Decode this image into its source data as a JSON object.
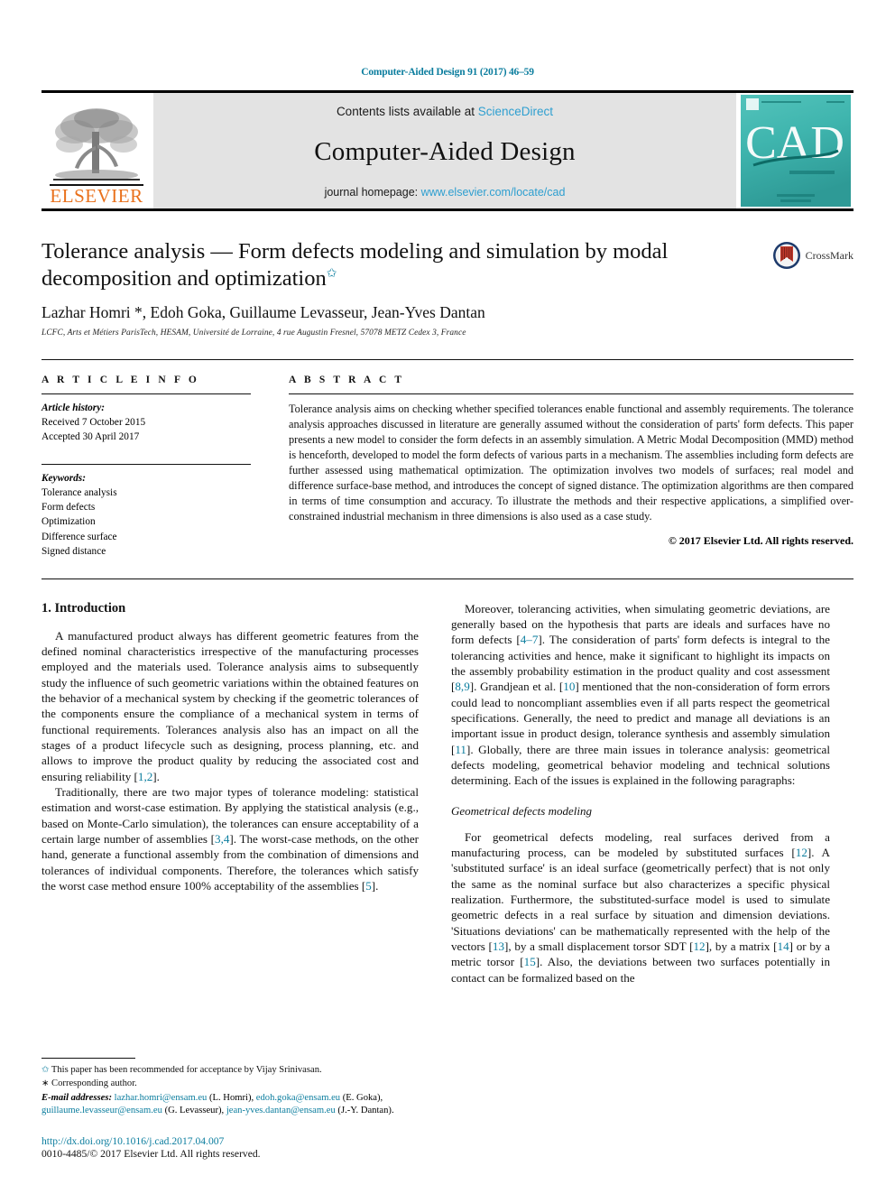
{
  "running_head": "Computer-Aided Design 91 (2017) 46–59",
  "masthead": {
    "publisher_name": "ELSEVIER",
    "contents_prefix": "Contents lists available at ",
    "sciencedirect": "ScienceDirect",
    "journal_name": "Computer-Aided Design",
    "homepage_prefix": "journal homepage: ",
    "homepage_url": "www.elsevier.com/locate/cad",
    "cover_title": "CAD",
    "cover_subtitle": "COMPUTER-AIDED DESIGN",
    "accent_color": "#2e9fd0",
    "link_color": "#0b7d9e",
    "cover_color": "#3fb5ae",
    "elsevier_orange": "#E9711C"
  },
  "article": {
    "title": "Tolerance analysis — Form defects modeling and simulation by modal decomposition and optimization",
    "title_footnote_mark": "✩",
    "authors": "Lazhar Homri *, Edoh Goka, Guillaume Levasseur, Jean-Yves Dantan",
    "affiliation": "LCFC, Arts et Métiers ParisTech, HESAM, Université de Lorraine, 4 rue Augustin Fresnel, 57078 METZ Cedex 3, France",
    "crossmark_label": "CrossMark"
  },
  "info": {
    "heading": "A R T I C L E   I N F O",
    "history_label": "Article history:",
    "history": [
      "Received 7 October 2015",
      "Accepted 30 April 2017"
    ],
    "keywords_label": "Keywords:",
    "keywords": [
      "Tolerance analysis",
      "Form defects",
      "Optimization",
      "Difference surface",
      "Signed distance"
    ]
  },
  "abstract": {
    "heading": "A B S T R A C T",
    "text": "Tolerance analysis aims on checking whether specified tolerances enable functional and assembly requirements. The tolerance analysis approaches discussed in literature are generally assumed without the consideration of parts' form defects. This paper presents a new model to consider the form defects in an assembly simulation. A Metric Modal Decomposition (MMD) method is henceforth, developed to model the form defects of various parts in a mechanism. The assemblies including form defects are further assessed using mathematical optimization. The optimization involves two models of surfaces; real model and difference surface-base method, and introduces the concept of signed distance. The optimization algorithms are then compared in terms of time consumption and accuracy. To illustrate the methods and their respective applications, a simplified over-constrained industrial mechanism in three dimensions is also used as a case study.",
    "copyright": "© 2017 Elsevier Ltd. All rights reserved."
  },
  "body": {
    "section_number_title": "1. Introduction",
    "left_paragraphs": [
      "A manufactured product always has  different geometric features from the defined nominal characteristics irrespective of the manufacturing processes employed and the materials used. Tolerance analysis aims to subsequently study the influence of such geometric variations within the obtained features on the behavior of a mechanical system by checking if the geometric tolerances of the components ensure the compliance of a mechanical system in terms of functional requirements. Tolerances analysis also has an impact on all the stages of a product lifecycle such as designing, process planning, etc. and allows to improve the product quality by reducing the associated cost and ensuring reliability [1,2].",
      "Traditionally, there are two major types of tolerance modeling: statistical estimation and worst-case estimation. By applying the statistical analysis (e.g., based on Monte-Carlo simulation), the tolerances can ensure acceptability of a certain large number of assemblies [3,4]. The worst-case methods, on the other hand, generate a functional assembly from the combination of dimensions and tolerances of individual components. Therefore, the tolerances which satisfy the worst case method ensure 100% acceptability of the assemblies [5]."
    ],
    "right_paragraphs": [
      "Moreover, tolerancing activities, when simulating geometric deviations, are generally based on the hypothesis that parts are ideals and surfaces have no form defects [4–7]. The consideration of parts' form defects is integral to the tolerancing activities and hence, make it significant to highlight its impacts on the assembly probability estimation in the product quality and cost assessment [8,9]. Grandjean et al. [10] mentioned that the non-consideration of form errors could lead to noncompliant assemblies even if all parts respect the geometrical specifications. Generally, the need to predict and manage all deviations is an important issue in product design, tolerance synthesis and assembly simulation [11]. Globally, there are three main issues in tolerance analysis: geometrical defects modeling, geometrical behavior modeling and technical solutions determining. Each of the issues is explained in the following paragraphs:"
    ],
    "right_subsection": "Geometrical defects modeling",
    "right_paragraphs_2": [
      "For geometrical defects modeling, real surfaces derived from a manufacturing process, can be modeled by substituted surfaces [12]. A 'substituted surface' is an ideal surface (geometrically perfect) that is not only the same as the nominal surface but also characterizes a specific physical realization. Furthermore, the substituted-surface model is used to simulate geometric defects in a real surface by situation and dimension deviations. 'Situations deviations' can be mathematically represented with the help of the vectors [13], by a small displacement torsor SDT [12], by a matrix [14] or by a metric torsor [15]. Also, the deviations between two surfaces potentially in contact can be formalized based on the"
    ]
  },
  "footnotes": {
    "acceptance_mark": "✩",
    "acceptance_note": "This paper has been recommended for acceptance by Vijay Srinivasan.",
    "corresponding_mark": "∗",
    "corresponding_note": "Corresponding author.",
    "email_label": "E-mail addresses:",
    "emails": [
      {
        "address": "lazhar.homri@ensam.eu",
        "person": "(L. Homri)"
      },
      {
        "address": "edoh.goka@ensam.eu",
        "person": "(E. Goka)"
      },
      {
        "address": "guillaume.levasseur@ensam.eu",
        "person": "(G. Levasseur)"
      },
      {
        "address": "jean-yves.dantan@ensam.eu",
        "person": "(J.-Y. Dantan)"
      }
    ]
  },
  "footer": {
    "doi": "http://dx.doi.org/10.1016/j.cad.2017.04.007",
    "issn_line": "0010-4485/© 2017 Elsevier Ltd. All rights reserved."
  }
}
